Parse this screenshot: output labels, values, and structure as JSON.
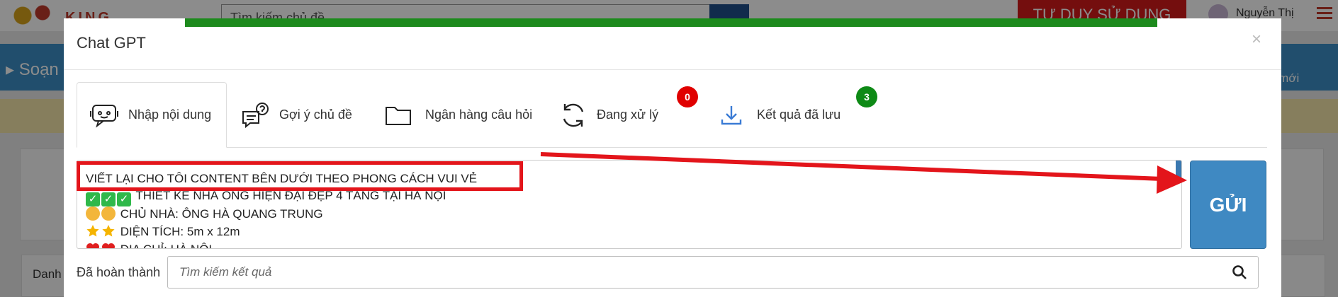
{
  "background": {
    "logo_text": "KING CONTENT",
    "search_placeholder": "Tìm kiếm chủ đề",
    "cta_label": "TƯ DUY SỬ DỤNG",
    "username": "Nguyễn Thị",
    "bar_left": "Soạn",
    "bar_right": "u mới",
    "card_text": "Danh"
  },
  "modal": {
    "title": "Chat GPT",
    "close": "×",
    "tabs": [
      {
        "label": "Nhập nội dung",
        "icon": "chat-bot-icon",
        "active": true
      },
      {
        "label": "Gợi ý chủ đề",
        "icon": "question-chat-icon",
        "active": false
      },
      {
        "label": "Ngân hàng câu hỏi",
        "icon": "folder-icon",
        "active": false
      },
      {
        "label": "Đang xử lý",
        "icon": "refresh-icon",
        "active": false,
        "badge": "0",
        "badge_color": "#e00000"
      },
      {
        "label": "Kết quả đã lưu",
        "icon": "download-icon",
        "active": false,
        "badge": "3",
        "badge_color": "#0e8a16"
      }
    ],
    "editor": {
      "lines": [
        "VIẾT LẠI CHO TÔI CONTENT BÊN DƯỚI THEO PHONG CÁCH VUI VẺ",
        "THIẾT KẾ NHÀ ỐNG HIỆN ĐẠI ĐẸP 4 TẦNG TẠI HÀ NỘI",
        "CHỦ NHÀ: ÔNG HÀ QUANG TRUNG",
        "DIỆN TÍCH: 5m x 12m",
        "ĐỊA CHỈ: HÀ NỘI"
      ]
    },
    "send_label": "GỬI",
    "done_label": "Đã hoàn thành",
    "result_placeholder": "Tìm kiếm kết quả"
  },
  "colors": {
    "progress": "#1d8a1d",
    "send_button": "#3f89c2",
    "annotation": "#e3151b"
  }
}
